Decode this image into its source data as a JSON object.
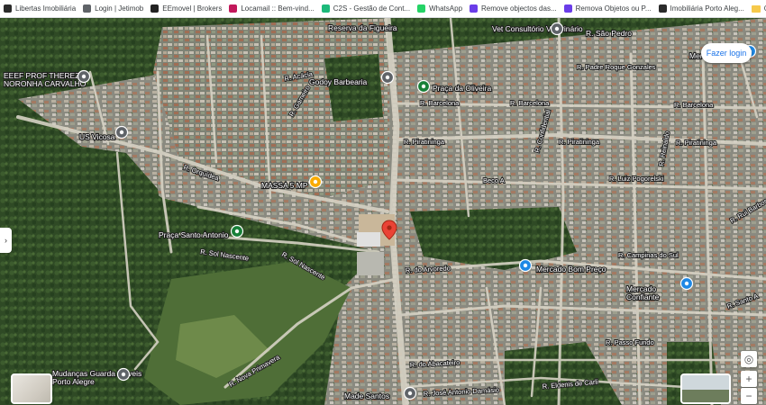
{
  "bookmarks": {
    "items": [
      {
        "label": "Libertas Imobiliária",
        "color": "#2b2b2b"
      },
      {
        "label": "Login | Jetimob",
        "color": "#5f6368"
      },
      {
        "label": "EEmovel | Brokers",
        "color": "#222222"
      },
      {
        "label": "Locamail :: Bem-vind...",
        "color": "#c2185b"
      },
      {
        "label": "C2S - Gestão de Cont...",
        "color": "#1db97a"
      },
      {
        "label": "WhatsApp",
        "color": "#25d366"
      },
      {
        "label": "Remove objectos das...",
        "color": "#6a3de8"
      },
      {
        "label": "Remova Objetos ou P...",
        "color": "#6a3de8"
      },
      {
        "label": "Imobiliária Porto Aleg...",
        "color": "#2b2b2b"
      }
    ],
    "other_label": "Outros favoritos"
  },
  "map": {
    "login_label": "Fazer login",
    "side_arrow": "›",
    "zoom_in": "+",
    "zoom_out": "−",
    "places": [
      {
        "name": "Reserva da Figueira"
      },
      {
        "name": "Vet Consultório Veterinário"
      },
      {
        "name": "R. São Pedro"
      },
      {
        "name": "Mercado Parada"
      },
      {
        "name": "EEEF PROF THEREZA NORONHA CARVALHO"
      },
      {
        "name": "Godoy Barbearia"
      },
      {
        "name": "Praça da Oliveira"
      },
      {
        "name": "US Vicosa"
      },
      {
        "name": "MASSA 5 MP"
      },
      {
        "name": "Praça Santo Antonio"
      },
      {
        "name": "Mercado Bom Preço"
      },
      {
        "name": "Mercado Confiante"
      },
      {
        "name": "Mudanças Guarda Moveis Porto Alegre"
      },
      {
        "name": "Made Santos"
      }
    ],
    "roads": [
      {
        "name": "R. Acácia"
      },
      {
        "name": "R. Gameiro"
      },
      {
        "name": "R. Barcelona"
      },
      {
        "name": "R. Barcelona"
      },
      {
        "name": "R. Barcelona"
      },
      {
        "name": "R. Piratininga"
      },
      {
        "name": "R. Piratininga"
      },
      {
        "name": "R. Piratininga"
      },
      {
        "name": "R. Luiz Pogorelski"
      },
      {
        "name": "R. Orquídea"
      },
      {
        "name": "R. Sol Nascente"
      },
      {
        "name": "R. Sol Nascente"
      },
      {
        "name": "R. do Arvoredo"
      },
      {
        "name": "R. Campinas do Sul"
      },
      {
        "name": "R. Santo A"
      },
      {
        "name": "R. Passo Fundo"
      },
      {
        "name": "R. do Abacateiro"
      },
      {
        "name": "R. José Antonio Damásio"
      },
      {
        "name": "R. Nova Primavera"
      },
      {
        "name": "R. Eldenis de Carli"
      },
      {
        "name": "R. Padre Roque Gonzales"
      },
      {
        "name": "R. Confidential"
      },
      {
        "name": "R. Rui Barbosa"
      },
      {
        "name": "Beco A"
      },
      {
        "name": "R. Reinaldo"
      }
    ]
  }
}
